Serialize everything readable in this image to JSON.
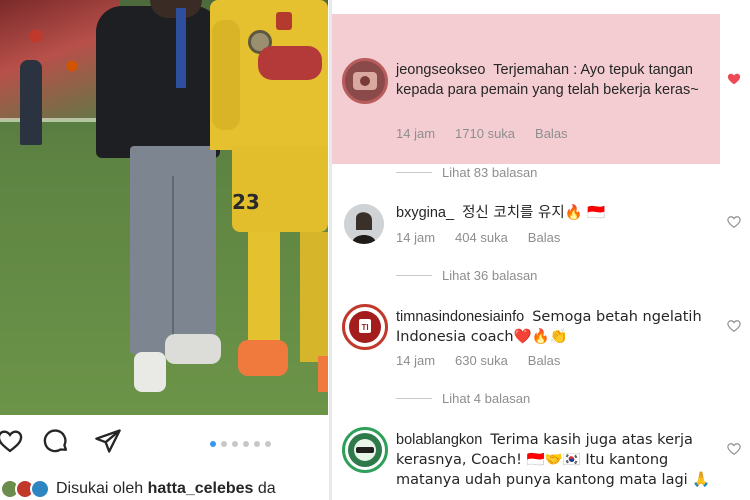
{
  "post": {
    "photo_alt": "",
    "gk_number": "23",
    "carousel": {
      "count": 6,
      "active": 0
    },
    "liked_prefix": "Disukai oleh",
    "liked_user": "hatta_celebes",
    "liked_suffix": "da"
  },
  "icons": {
    "like": "heart-outline-icon",
    "comment": "speech-bubble-icon",
    "share": "paper-plane-icon",
    "comment_like": "heart-icon"
  },
  "colors": {
    "highlight": "#f4cdd2",
    "liked_heart": "#ed4956",
    "active_dot": "#3897f0",
    "muted_text": "#8e8e8e"
  },
  "comments": [
    {
      "user": "jeongseokseo",
      "text": "Terjemahan : Ayo tepuk tangan kepada para pemain yang telah bekerja keras~",
      "time": "14 jam",
      "likes": "1710 suka",
      "reply": "Balas",
      "view_replies": "Lihat 83 balasan",
      "liked": true
    },
    {
      "user": "bxygina_",
      "text": "정신 코치를 유지🔥 🇮🇩",
      "time": "14 jam",
      "likes": "404 suka",
      "reply": "Balas",
      "view_replies": "Lihat 36 balasan",
      "liked": false
    },
    {
      "user": "timnasindonesiainfo",
      "text": "Semoga betah ngelatih Indonesia coach❤️🔥👏",
      "time": "14 jam",
      "likes": "630 suka",
      "reply": "Balas",
      "view_replies": "Lihat 4 balasan",
      "liked": false
    },
    {
      "user": "bolablangkon",
      "text": "Terima kasih juga atas kerja kerasnya, Coach! 🇮🇩🤝🇰🇷 Itu kantong matanya udah punya kantong mata lagi 🙏",
      "liked": false
    }
  ]
}
